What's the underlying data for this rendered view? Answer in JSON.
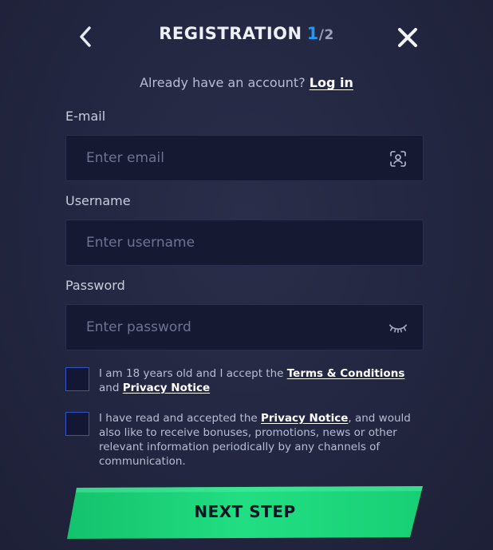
{
  "header": {
    "title": "REGISTRATION",
    "step_current": "1",
    "step_separator": "/",
    "step_total": "2"
  },
  "login": {
    "prompt": "Already have an account?",
    "link_label": "Log in"
  },
  "form": {
    "email": {
      "label": "E-mail",
      "placeholder": "Enter email",
      "value": ""
    },
    "username": {
      "label": "Username",
      "placeholder": "Enter username",
      "value": ""
    },
    "password": {
      "label": "Password",
      "placeholder": "Enter password",
      "value": ""
    }
  },
  "consent": {
    "age": {
      "text_before": "I am 18 years old and I accept the ",
      "terms_link": "Terms & Conditions",
      "text_middle": " and ",
      "privacy_link": "Privacy Notice",
      "checked": false
    },
    "marketing": {
      "text_before": "I have read and accepted the ",
      "privacy_link": "Privacy Notice",
      "text_after": ", and would also like to receive bonuses, promotions, news or other relevant information periodically by any channels of communication.",
      "checked": false
    }
  },
  "next_button": {
    "label": "NEXT STEP"
  },
  "icons": {
    "back": "chevron-left-icon",
    "close": "close-icon",
    "email_field": "face-scan-icon",
    "password_field": "eye-closed-icon"
  },
  "colors": {
    "accent_blue": "#2196f3",
    "button_green": "#1fd97d",
    "checkbox_border": "#2f55c8"
  }
}
